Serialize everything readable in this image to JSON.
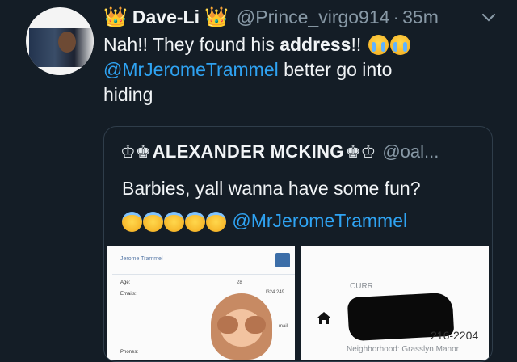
{
  "tweet": {
    "crown_left": "👑",
    "display_name": "Dave-Li",
    "crown_right": "👑",
    "handle": "@Prince_virgo914",
    "separator": "·",
    "time": "35m",
    "text_line1_prefix": "Nah!! They found his ",
    "text_line1_bold": "address",
    "text_line1_suffix": "!!",
    "mention": "@MrJeromeTrammel",
    "text_line2_suffix": " better go into",
    "text_line3": "hiding"
  },
  "quote": {
    "symbol_left": "♔♚",
    "name": "ALEXANDER MCKING",
    "symbol_right": "♚♔",
    "handle": "@oal...",
    "text_line1": "Barbies, yall wanna have some fun?",
    "mention": "@MrJeromeTrammel",
    "halo_emoji_count": 5
  },
  "thumb1": {
    "title": "Jerome Trammel",
    "age_label": "Age:",
    "age_value": "28",
    "emails_label": "Emails:",
    "emails_value": "l324.249",
    "email2": "mail",
    "phones_label": "Phones:"
  },
  "thumb2": {
    "label": "CURR",
    "phone_fragment": "216-2204",
    "neighborhood": "Neighborhood: Grasslyn Manor"
  },
  "colors": {
    "background": "#141d26",
    "mention": "#2fa3f2",
    "secondary_text": "#8899a6",
    "crown": "#f0b81f"
  },
  "icons": [
    "chevron-down-icon",
    "crown-icon",
    "loudly-crying-face-icon",
    "smiling-face-with-halo-icon",
    "home-icon",
    "see-no-evil-monkey-icon"
  ]
}
